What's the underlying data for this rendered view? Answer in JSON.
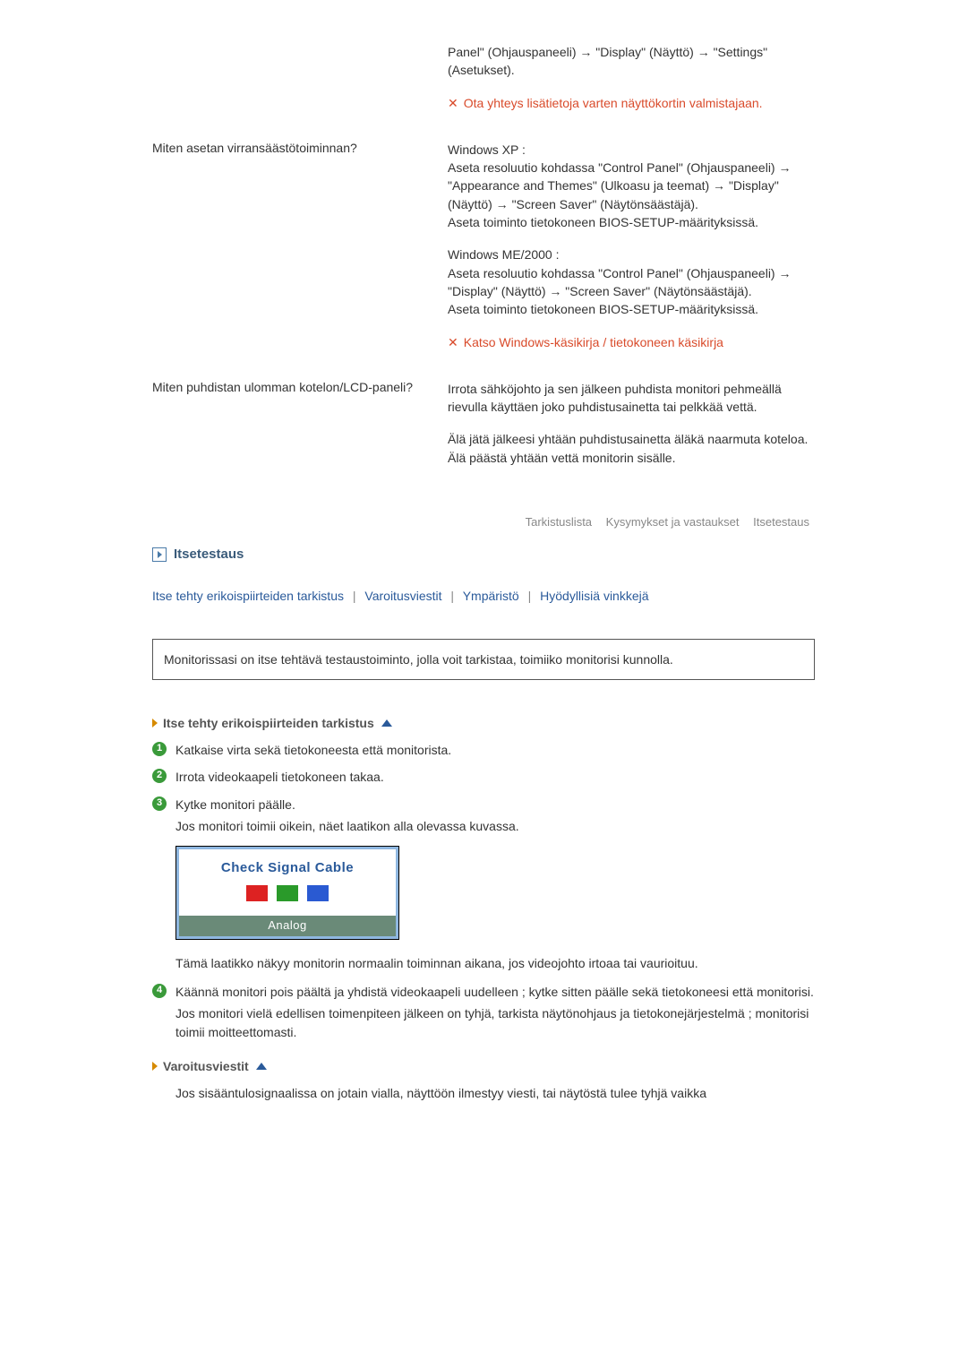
{
  "faq": [
    {
      "q": "",
      "answers": [
        {
          "type": "text",
          "value": "Panel\" (Ohjauspaneeli) → \"Display\" (Näyttö) → \"Settings\" (Asetukset)."
        },
        {
          "type": "note",
          "value": "Ota yhteys lisätietoja varten näyttökortin valmistajaan."
        }
      ]
    },
    {
      "q": "Miten asetan virransäästötoiminnan?",
      "answers": [
        {
          "type": "text",
          "value": "Windows XP :\nAseta resoluutio kohdassa \"Control Panel\" (Ohjauspaneeli) → \"Appearance and Themes\" (Ulkoasu ja teemat) → \"Display\" (Näyttö) → \"Screen Saver\" (Näytönsäästäjä).\nAseta toiminto tietokoneen BIOS-SETUP-määrityksissä."
        },
        {
          "type": "text",
          "value": "Windows ME/2000 :\nAseta resoluutio kohdassa \"Control Panel\" (Ohjauspaneeli) → \"Display\" (Näyttö) → \"Screen Saver\" (Näytönsäästäjä).\nAseta toiminto tietokoneen BIOS-SETUP-määrityksissä."
        },
        {
          "type": "note",
          "value": "Katso Windows-käsikirja / tietokoneen käsikirja"
        }
      ]
    },
    {
      "q": "Miten puhdistan ulomman kotelon/LCD-paneli?",
      "answers": [
        {
          "type": "text",
          "value": "Irrota sähköjohto ja sen jälkeen puhdista monitori pehmeällä rievulla käyttäen joko puhdistusainetta tai pelkkää vettä."
        },
        {
          "type": "text",
          "value": "Älä jätä jälkeesi yhtään puhdistusainetta äläkä naarmuta koteloa. Älä päästä yhtään vettä monitorin sisälle."
        }
      ]
    }
  ],
  "nav": {
    "a": "Tarkistuslista",
    "b": "Kysymykset ja vastaukset",
    "c": "Itsetestaus"
  },
  "section": {
    "title": "Itsetestaus"
  },
  "jump": {
    "a": "Itse tehty erikoispiirteiden tarkistus",
    "b": "Varoitusviestit",
    "c": "Ympäristö",
    "d": "Hyödyllisiä vinkkejä"
  },
  "info_box": "Monitorissasi on itse tehtävä testaustoiminto, jolla voit tarkistaa, toimiiko monitorisi kunnolla.",
  "sub1": {
    "title": "Itse tehty erikoispiirteiden tarkistus"
  },
  "steps": {
    "s1": "Katkaise virta sekä tietokoneesta että monitorista.",
    "s2": "Irrota videokaapeli tietokoneen takaa.",
    "s3": "Kytke monitori päälle.",
    "s3b": "Jos monitori toimii oikein, näet laatikon alla olevassa kuvassa.",
    "img_title": "Check Signal Cable",
    "img_bar": "Analog",
    "after_img": "Tämä laatikko näkyy monitorin normaalin toiminnan aikana, jos videojohto irtoaa tai vaurioituu.",
    "s4": "Käännä monitori pois päältä ja yhdistä videokaapeli uudelleen ; kytke sitten päälle sekä tietokoneesi että monitorisi.",
    "s4b": "Jos monitori vielä edellisen toimenpiteen jälkeen on tyhjä, tarkista näytönohjaus ja tietokonejärjestelmä ; monitorisi toimii moitteettomasti."
  },
  "sub2": {
    "title": "Varoitusviestit"
  },
  "warn_para": "Jos sisääntulosignaalissa on jotain vialla, näyttöön ilmestyy viesti, tai näytöstä tulee tyhjä vaikka"
}
